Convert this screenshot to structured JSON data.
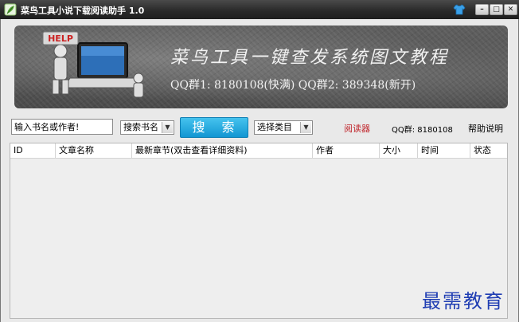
{
  "window": {
    "title": "菜鸟工具小说下载阅读助手 1.0",
    "minimize_glyph": "–",
    "maximize_glyph": "□",
    "close_glyph": "✕"
  },
  "banner": {
    "help_text": "HELP",
    "slogan": "菜鸟工具一键查发系统图文教程",
    "qq_line": "QQ群1: 8180108(快满) QQ群2: 389348(新开)"
  },
  "toolbar": {
    "search_value": "输入书名或作者!",
    "search_type": "搜索书名",
    "search_button": "搜 索",
    "category": "选择类目",
    "reader": "阅读器",
    "qq_group": "QQ群: 8180108",
    "help": "帮助说明"
  },
  "table": {
    "columns": [
      "ID",
      "文章名称",
      "最新章节(双击查看详细资料)",
      "作者",
      "大小",
      "时间",
      "状态"
    ]
  },
  "watermark": "最需教育",
  "colors": {
    "accent": "#1296d2",
    "reader_link": "#c1272d",
    "titlebar": "#2a2a2a"
  },
  "icons": {
    "app": "leaf-icon",
    "skin": "shirt-icon"
  }
}
